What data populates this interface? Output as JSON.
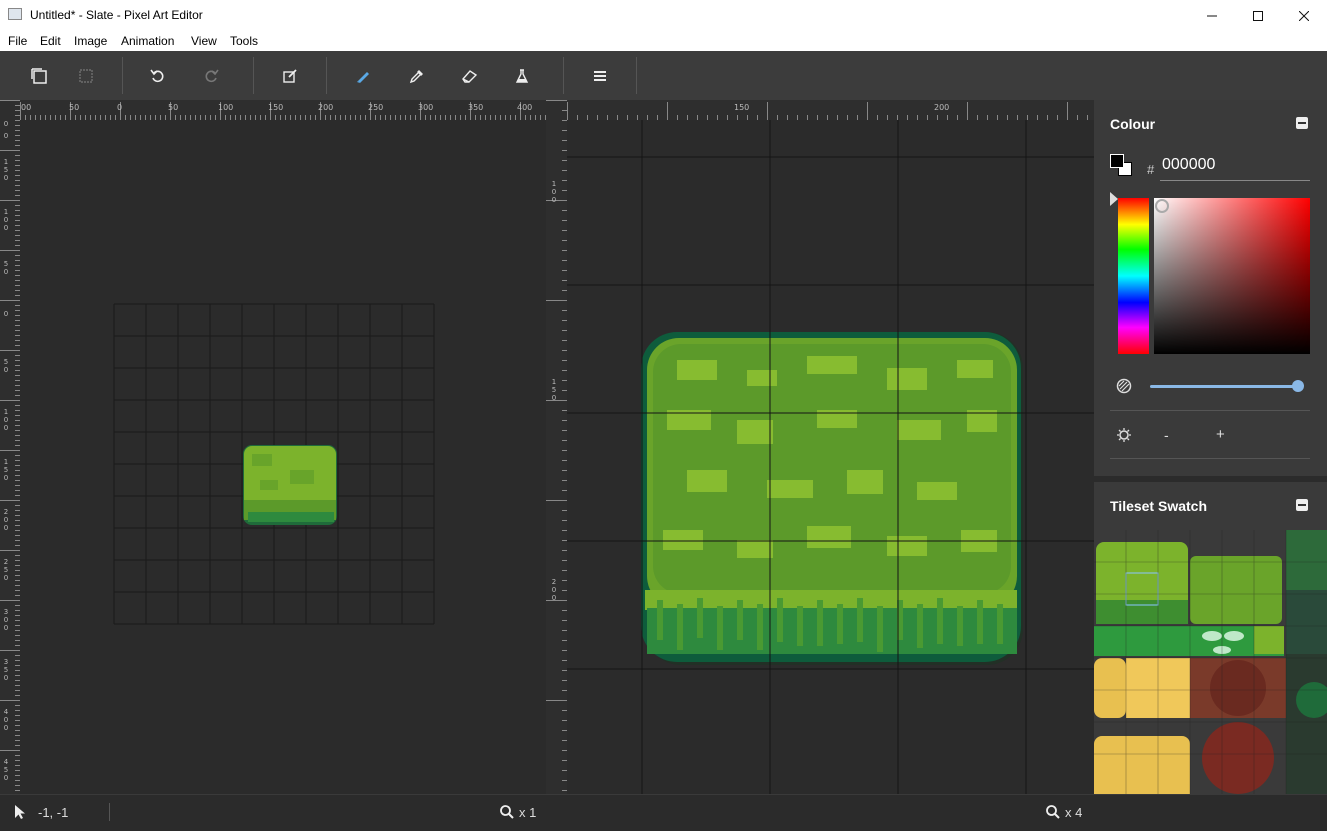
{
  "window": {
    "title": "Untitled* - Slate - Pixel Art Editor"
  },
  "menu": [
    "File",
    "Edit",
    "Image",
    "Animation",
    "View",
    "Tools"
  ],
  "toolbar": {
    "icons": [
      "canvas-size-icon",
      "image-size-icon",
      "undo-icon",
      "redo-icon",
      "edit-icon",
      "pen-icon",
      "eyedropper-icon",
      "eraser-icon",
      "fill-icon",
      "menu-icon"
    ]
  },
  "rulers": {
    "top_left_labels": [
      "00",
      "50",
      "0",
      "50",
      "100",
      "150",
      "200",
      "250",
      "300",
      "350",
      "400"
    ],
    "top_right_labels": [
      "150",
      "200"
    ],
    "left_labels": [
      "0",
      "0",
      "1\n5\n0",
      "1\n0\n0",
      "5\n0",
      "0",
      "5\n0",
      "1\n0\n0",
      "1\n5\n0",
      "2\n0\n0",
      "2\n5\n0",
      "3\n0\n0",
      "3\n5\n0",
      "4\n0\n0",
      "4\n5\n0"
    ],
    "mid_labels": [
      "1\n0\n0",
      "1\n5\n0",
      "2\n0\n0"
    ]
  },
  "colour_panel": {
    "title": "Colour",
    "hash": "#",
    "hex": "000000",
    "primary_color": "#000000",
    "secondary_color": "#ffffff",
    "saturation_decrease": "-",
    "saturation_increase": "+",
    "opacity_fraction": 1.0
  },
  "tileset_panel": {
    "title": "Tileset Swatch"
  },
  "status": {
    "cursor_pos": "-1, -1",
    "zoom_left": "x 1",
    "zoom_right": "x 4"
  },
  "colors": {
    "grass_light": "#7cb32c",
    "grass_mid": "#5c9a2a",
    "grass_dark": "#1f6b3a",
    "grass_edge": "#0e5c3c",
    "accent_blue": "#5aa9e6"
  }
}
